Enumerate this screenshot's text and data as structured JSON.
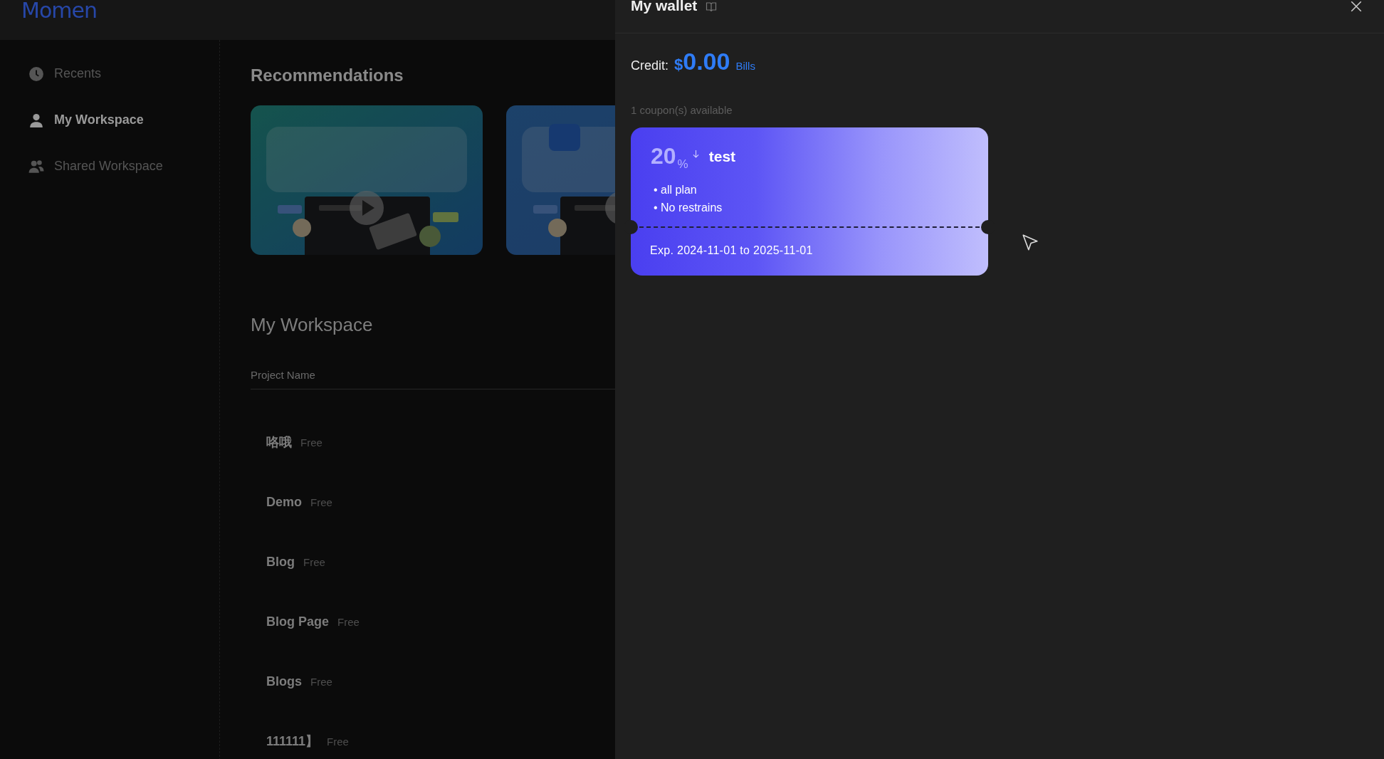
{
  "logo": {
    "text": "Momen"
  },
  "sidebar": {
    "items": [
      {
        "label": "Recents",
        "selected": false
      },
      {
        "label": "My Workspace",
        "selected": true
      },
      {
        "label": "Shared Workspace",
        "selected": false
      }
    ]
  },
  "recommendations": {
    "title": "Recommendations"
  },
  "workspace": {
    "title": "My Workspace",
    "columns": [
      "Project Name"
    ],
    "projects": [
      {
        "name": "咯哦",
        "plan": "Free"
      },
      {
        "name": "Demo",
        "plan": "Free"
      },
      {
        "name": "Blog",
        "plan": "Free"
      },
      {
        "name": "Blog Page",
        "plan": "Free"
      },
      {
        "name": "Blogs",
        "plan": "Free"
      },
      {
        "name": "111111】",
        "plan": "Free"
      }
    ]
  },
  "wallet": {
    "title": "My wallet",
    "credit_label": "Credit:",
    "currency": "$",
    "amount": "0.00",
    "bills_link": "Bills",
    "coupons_label": "1 coupon(s) available",
    "coupons": [
      {
        "discount": "20",
        "unit": "%",
        "name": "test",
        "conditions": [
          "• all plan",
          "• No restrains"
        ],
        "expiry": "Exp. 2024-11-01 to 2025-11-01"
      }
    ]
  }
}
